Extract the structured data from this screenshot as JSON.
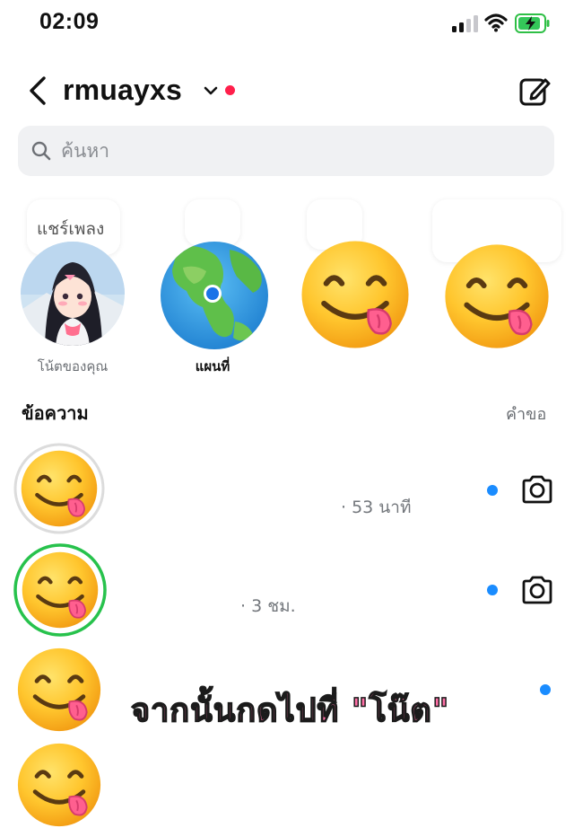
{
  "status": {
    "time": "02:09"
  },
  "header": {
    "username": "rmuayxs"
  },
  "search": {
    "placeholder": "ค้นหา"
  },
  "notes": [
    {
      "bubble": "แชร์เพลง",
      "label": "โน้ตของคุณ",
      "kind": "own-avatar"
    },
    {
      "bubble": "",
      "label": "แผนที่",
      "kind": "map"
    },
    {
      "bubble": "",
      "label": "",
      "kind": "emoji"
    },
    {
      "bubble": "",
      "label": "",
      "kind": "emoji"
    }
  ],
  "messages": {
    "title": "ข้อความ",
    "requests": "คำขอ",
    "items": [
      {
        "meta": "· 53 นาที",
        "unread": true,
        "camera": true,
        "ring": "gray"
      },
      {
        "meta": "· 3 ชม.",
        "unread": true,
        "camera": true,
        "ring": "green"
      },
      {
        "meta": "",
        "unread": true,
        "camera": false,
        "ring": "none"
      }
    ]
  },
  "overlay": {
    "caption": "จากนั้นกดไปที่ \"โน๊ต\""
  },
  "colors": {
    "unread_dot": "#1a8cff",
    "active_dot": "#ff1f4b",
    "close_friend_ring": "#27c24c",
    "caption": "#ff6fa6"
  }
}
